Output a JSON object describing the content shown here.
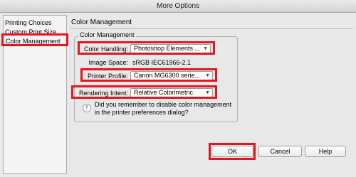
{
  "window": {
    "title": "More Options"
  },
  "sidebar": {
    "items": [
      {
        "label": "Printing Choices"
      },
      {
        "label": "Custom Print Size"
      },
      {
        "label": "Color Management"
      }
    ]
  },
  "pane": {
    "title": "Color Management"
  },
  "group": {
    "title": "Color Management",
    "color_handling": {
      "label": "Color Handling:",
      "value": "Photoshop Elements ..."
    },
    "image_space": {
      "label": "Image Space:",
      "value": "sRGB IEC61966-2.1"
    },
    "printer_profile": {
      "label": "Printer Profile:",
      "value": "Canon MG6300 serie..."
    },
    "rendering_intent": {
      "label": "Rendering Intent:",
      "value": "Relative Colorimetric"
    },
    "info": {
      "icon": "info-icon",
      "text": "Did you remember to disable color management in the printer preferences dialog?"
    }
  },
  "buttons": {
    "ok": "OK",
    "cancel": "Cancel",
    "help": "Help"
  },
  "colors": {
    "highlight": "#e3161f",
    "selection": "#3b76d0"
  }
}
